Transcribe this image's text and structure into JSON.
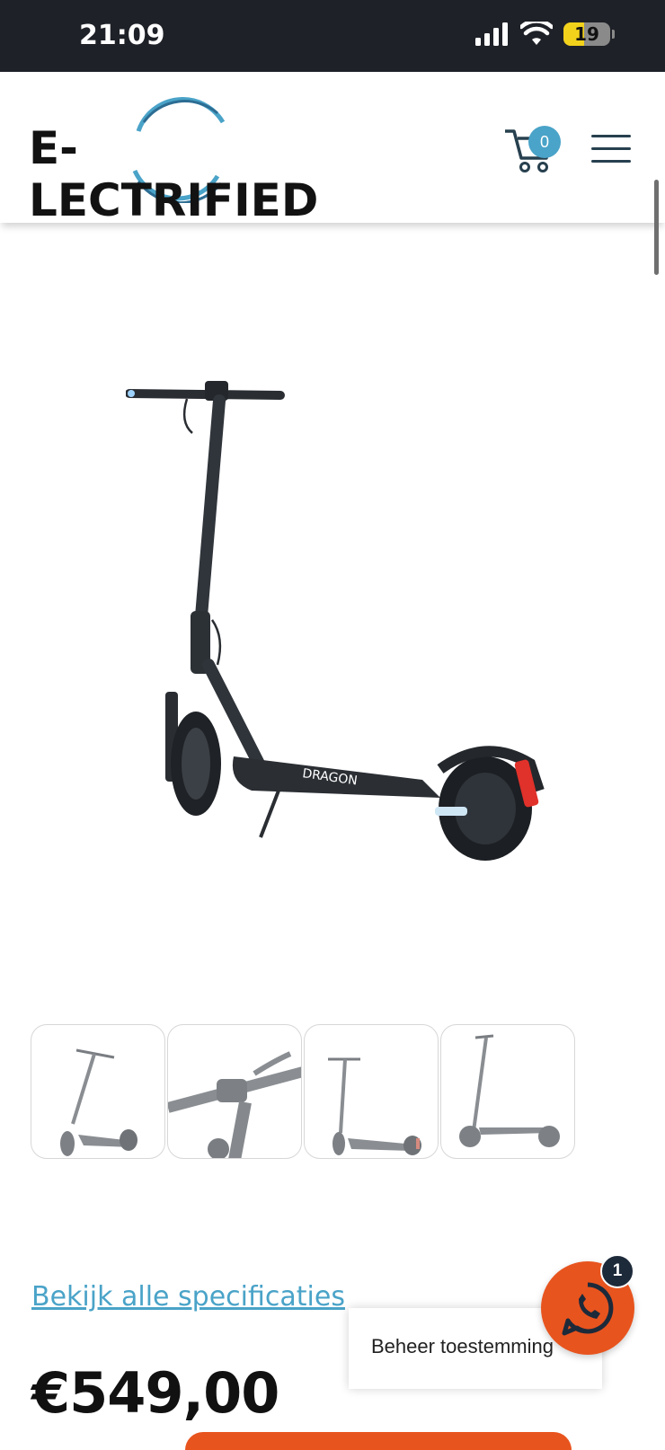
{
  "status_bar": {
    "time": "21:09",
    "battery": "19",
    "battery_level": 0.19
  },
  "header": {
    "logo_text": "E-LECTRIFIED",
    "cart_count": "0",
    "icons": [
      "cart-icon",
      "hamburger-menu-icon"
    ]
  },
  "product": {
    "image_alt": "scooter-photo",
    "thumbnails": [
      "scooter-side-view",
      "handlebar-closeup",
      "scooter-front-view",
      "scooter-profile-view"
    ],
    "specs_link": "Bekijk alle specificaties",
    "price": "€549,00"
  },
  "consent": {
    "label": "Beheer toestemming"
  },
  "whatsapp": {
    "badge": "1",
    "icon": "whatsapp-icon"
  },
  "colors": {
    "accent_blue": "#4aa3c8",
    "cta_orange": "#e8541e",
    "dark": "#1f2128"
  }
}
